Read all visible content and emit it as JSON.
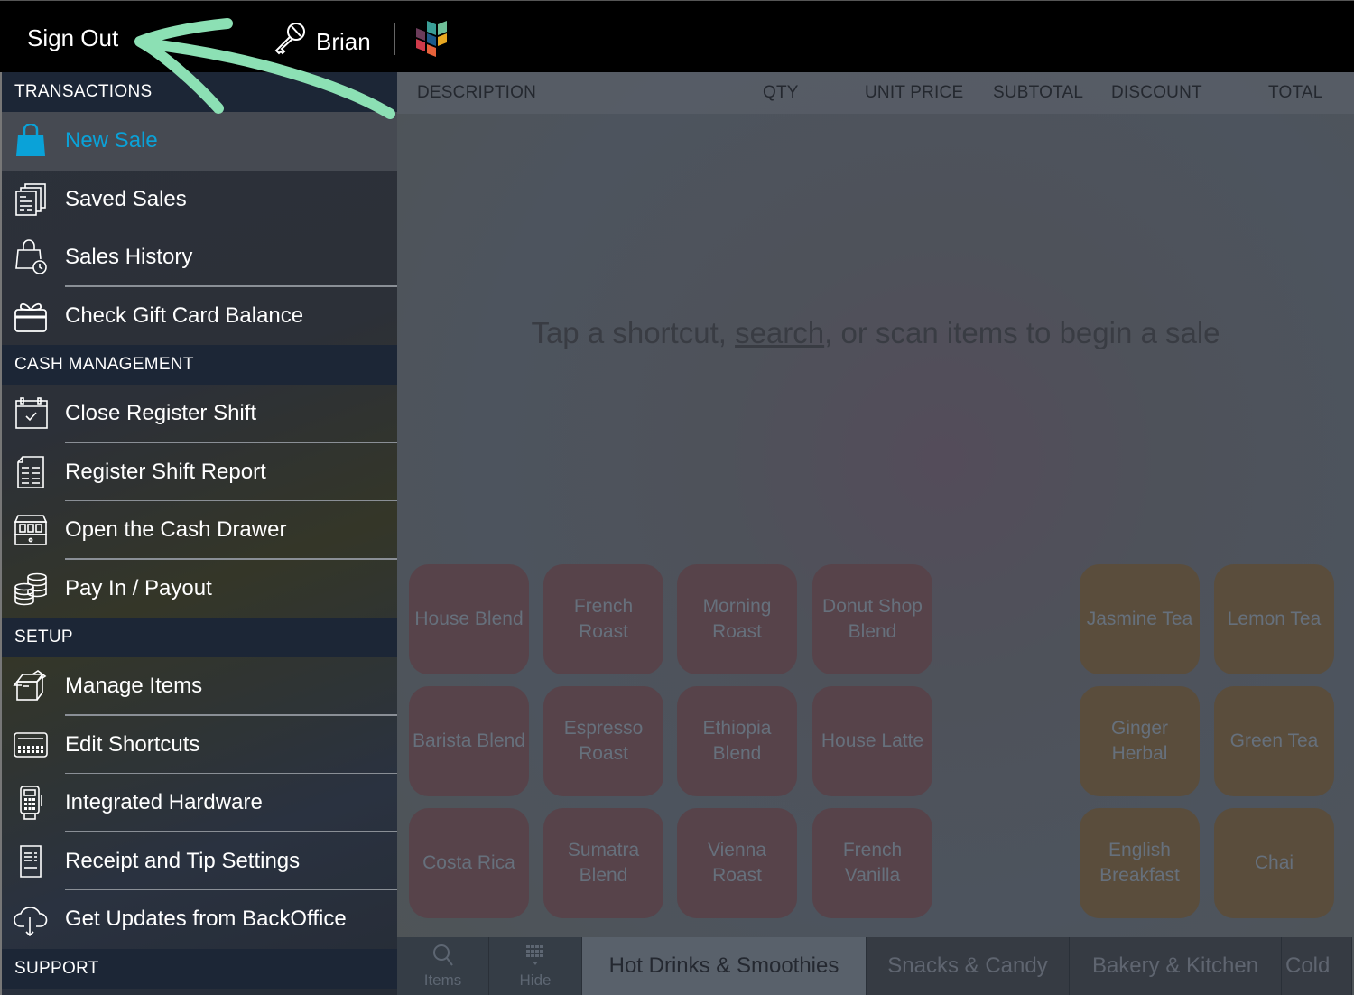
{
  "topbar": {
    "sign_out_label": "Sign Out",
    "user_name": "Brian",
    "user_icon": "key-icon",
    "logo_icon": "app-logo-icon"
  },
  "sidebar": {
    "sections": [
      {
        "title": "TRANSACTIONS",
        "items": [
          {
            "label": "New Sale",
            "icon": "shopping-bag-icon",
            "active": true
          },
          {
            "label": "Saved Sales",
            "icon": "saved-documents-icon"
          },
          {
            "label": "Sales History",
            "icon": "bag-clock-icon"
          },
          {
            "label": "Check Gift Card Balance",
            "icon": "gift-card-icon"
          }
        ]
      },
      {
        "title": "CASH MANAGEMENT",
        "items": [
          {
            "label": "Close Register Shift",
            "icon": "calendar-check-icon"
          },
          {
            "label": "Register Shift Report",
            "icon": "report-icon"
          },
          {
            "label": "Open the Cash Drawer",
            "icon": "cash-drawer-icon"
          },
          {
            "label": "Pay In / Payout",
            "icon": "coins-icon"
          }
        ]
      },
      {
        "title": "SETUP",
        "items": [
          {
            "label": "Manage Items",
            "icon": "open-box-icon"
          },
          {
            "label": "Edit Shortcuts",
            "icon": "keypad-icon"
          },
          {
            "label": "Integrated Hardware",
            "icon": "card-terminal-icon"
          },
          {
            "label": "Receipt and Tip Settings",
            "icon": "receipt-icon"
          },
          {
            "label": "Get Updates from BackOffice",
            "icon": "cloud-download-icon"
          }
        ]
      },
      {
        "title": "SUPPORT",
        "items": []
      }
    ]
  },
  "main": {
    "columns": [
      "DESCRIPTION",
      "QTY",
      "UNIT PRICE",
      "SUBTOTAL",
      "DISCOUNT",
      "TOTAL"
    ],
    "empty_message": {
      "before": "Tap a shortcut, ",
      "link": "search",
      "after": ", or scan items to begin a sale"
    },
    "coffee_shortcuts": [
      "House Blend",
      "French Roast",
      "Morning Roast",
      "Donut Shop Blend",
      "Barista Blend",
      "Espresso Roast",
      "Ethiopia Blend",
      "House Latte",
      "Costa Rica",
      "Sumatra Blend",
      "Vienna Roast",
      "French Vanilla"
    ],
    "tea_shortcuts": [
      "Jasmine Tea",
      "Lemon Tea",
      "Ginger Herbal",
      "Green Tea",
      "English Breakfast",
      "Chai"
    ],
    "bottom_buttons": [
      {
        "label": "Items",
        "icon": "search-icon"
      },
      {
        "label": "Hide",
        "icon": "keypad-hide-icon"
      }
    ],
    "category_tabs": [
      {
        "label": "Hot Drinks & Smoothies",
        "active": true
      },
      {
        "label": "Snacks & Candy",
        "active": false
      },
      {
        "label": "Bakery & Kitchen",
        "active": false
      },
      {
        "label": "Cold",
        "active": false
      }
    ]
  },
  "colors": {
    "accent": "#0aa2d8",
    "annotation_arrow": "#8ce0b4",
    "coffee_tile": "#57434a",
    "tea_tile": "#5a4d3c"
  }
}
